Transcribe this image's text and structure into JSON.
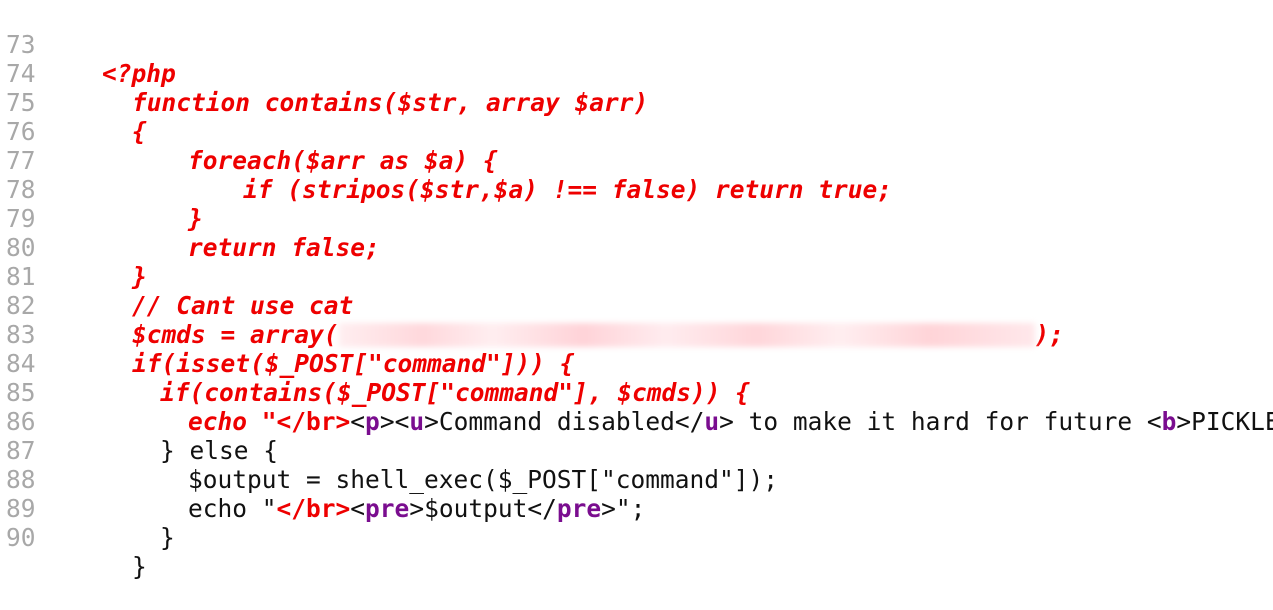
{
  "line_numbers": [
    "73",
    "74",
    "75",
    "76",
    "77",
    "78",
    "79",
    "80",
    "81",
    "82",
    "83",
    "84",
    "85",
    "86",
    "87",
    "88",
    "89",
    "90"
  ],
  "code": {
    "l73": "<?php",
    "l74": "function contains($str, array $arr)",
    "l75": "{",
    "l76": "foreach($arr as $a) {",
    "l77": "if (stripos($str,$a) !== false) return true;",
    "l78": "}",
    "l79": "return false;",
    "l80": "}",
    "l81": "// Cant use cat",
    "l82_start": "$cmds = array(",
    "l82_end": ");",
    "l83": "if(isset($_POST[\"command\"])) {",
    "l84": "if(contains($_POST[\"command\"], $cmds)) {",
    "l85_echo": "echo \"",
    "l85_br": "</br>",
    "l85_lt1": "<",
    "l85_p": "p",
    "l85_gt1": "><",
    "l85_u": "u",
    "l85_text1": ">Command disabled</",
    "l85_u2": "u",
    "l85_text2": "> to make it hard for future <",
    "l85_b": "b",
    "l85_text3": ">PICKLEEEE",
    "l86": "} else {",
    "l87": "$output = shell_exec($_POST[\"command\"]);",
    "l88_echo": "echo \"",
    "l88_br": "</br>",
    "l88_lt1": "<",
    "l88_pre": "pre",
    "l88_text1": ">$output</",
    "l88_pre2": "pre",
    "l88_text2": ">\";",
    "l89": "}",
    "l90": "}"
  },
  "colors": {
    "php_code": "#ee0000",
    "html_tag": "#7a0d8f",
    "plain_text": "#111111",
    "line_number": "#a8a8a8"
  }
}
